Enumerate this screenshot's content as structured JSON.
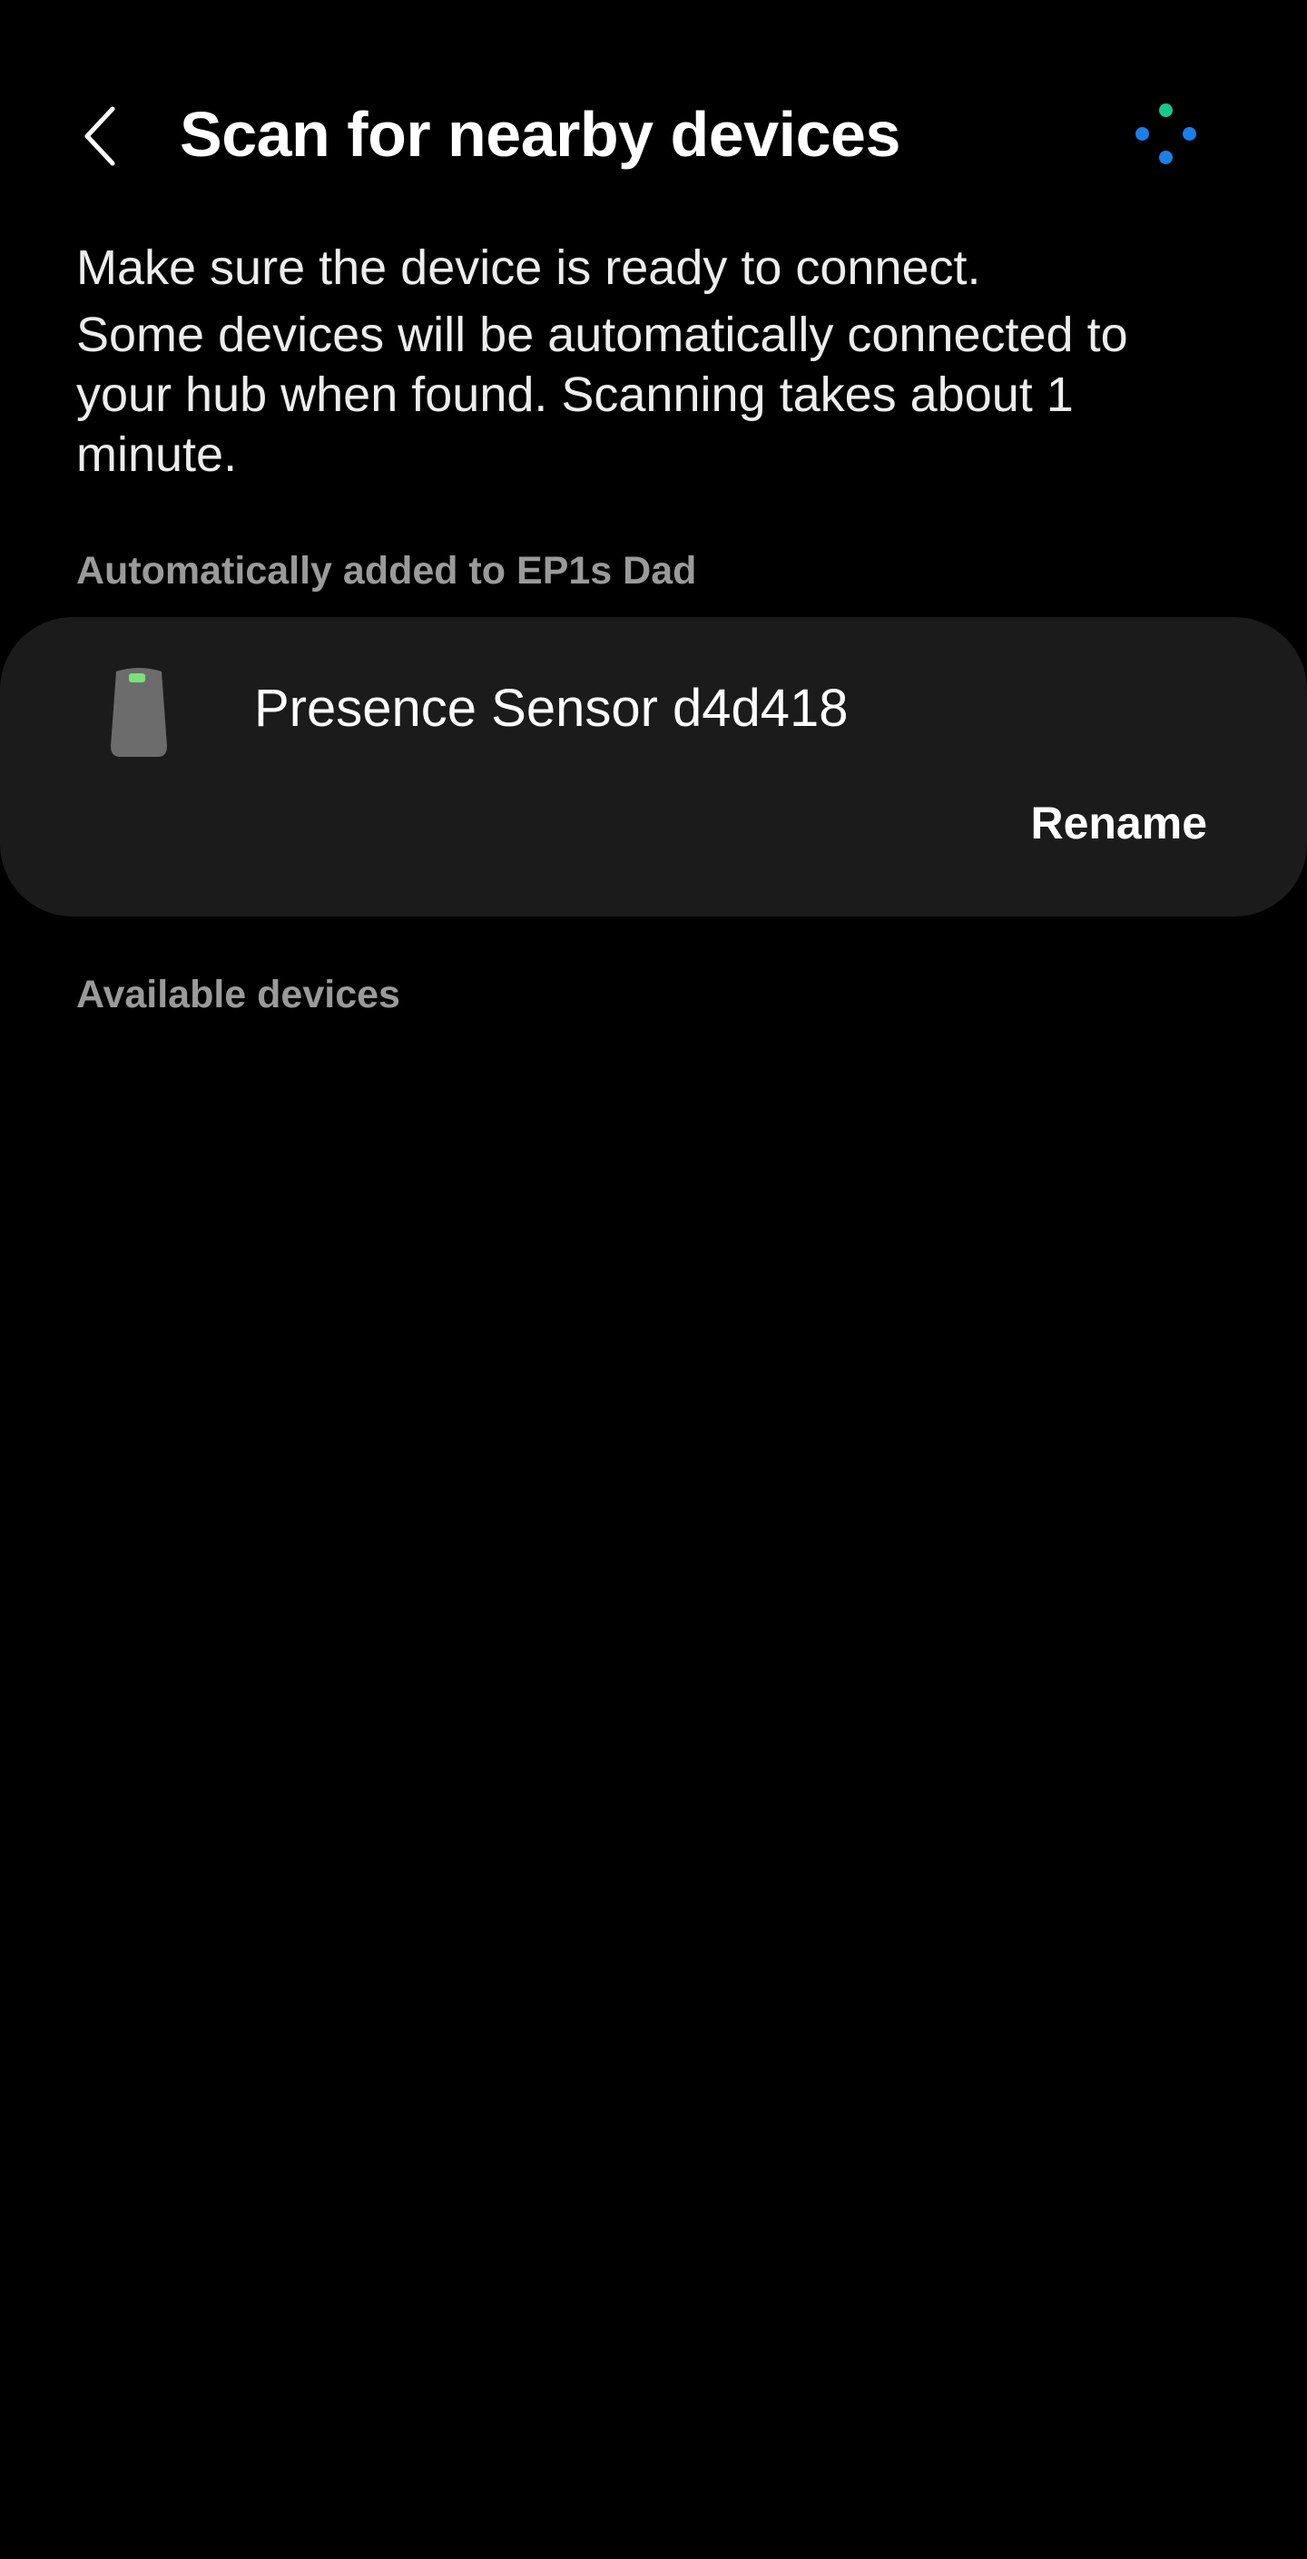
{
  "header": {
    "title": "Scan for nearby devices",
    "back_icon": "chevron-left-icon",
    "scan_indicator_icon": "scanning-dots-icon",
    "scan_dot_colors": [
      "#16c98d",
      "#1a7fe8",
      "#1a7fe8",
      "#1a7fe8"
    ]
  },
  "description": {
    "line1": "Make sure the device is ready to connect.",
    "line2": "Some devices will be automatically connected to your hub when found. Scanning takes about 1 minute."
  },
  "sections": {
    "auto_added_label": "Automatically added to EP1s Dad",
    "available_label": "Available devices"
  },
  "added_device": {
    "name": "Presence Sensor d4d418",
    "icon": "presence-sensor-icon",
    "action_label": "Rename"
  },
  "colors": {
    "background": "#000000",
    "card": "#1b1b1b",
    "section_label": "#9a9a9a",
    "sensor_led": "#7be07a"
  }
}
